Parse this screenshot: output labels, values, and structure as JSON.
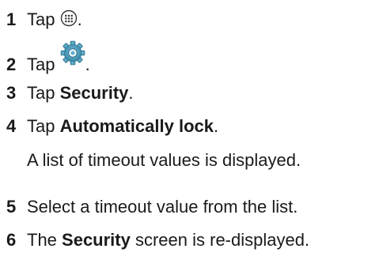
{
  "steps": [
    {
      "number": "1",
      "prefix": "Tap ",
      "icon": "apps-grid-icon",
      "suffix": "."
    },
    {
      "number": "2",
      "prefix": "Tap ",
      "icon": "settings-gear-icon",
      "suffix": "."
    },
    {
      "number": "3",
      "prefix": "Tap ",
      "bold": "Security",
      "suffix": "."
    },
    {
      "number": "4",
      "prefix": "Tap ",
      "bold": "Automatically lock",
      "suffix": "."
    },
    {
      "number": "5",
      "text": "Select a timeout value from the list."
    },
    {
      "number": "6",
      "prefix": "The ",
      "bold": "Security",
      "suffix": " screen is re-displayed."
    }
  ],
  "notes": {
    "after_step_4": "A list of timeout values is displayed."
  },
  "colors": {
    "text": "#1a1a1a",
    "gear_accent": "#3e8fae"
  }
}
